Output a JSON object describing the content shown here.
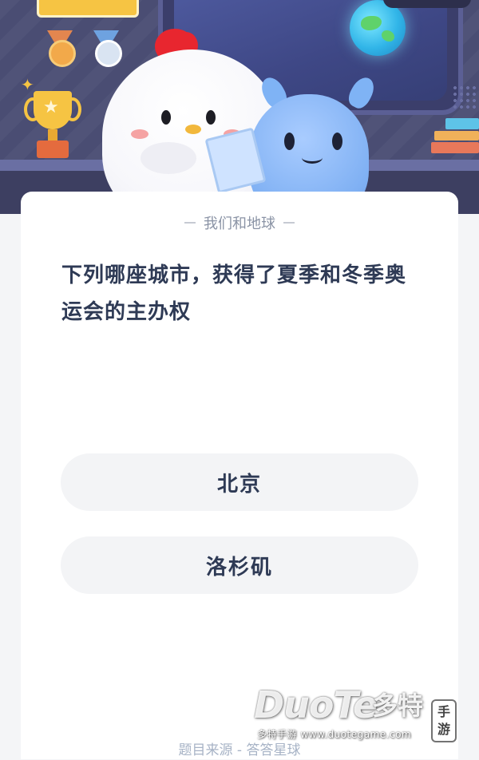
{
  "quiz": {
    "category": "我们和地球",
    "question": "下列哪座城市，获得了夏季和冬季奥运会的主办权",
    "options": [
      {
        "label": "北京"
      },
      {
        "label": "洛杉矶"
      }
    ],
    "source": "题目来源 - 答答星球"
  },
  "watermark": {
    "brand": "DuoTe",
    "brand_cn": "多特",
    "seal_1": "手",
    "seal_2": "游",
    "url": "多特手游 www.duotegame.com"
  },
  "icons": [
    "medal-bronze-icon",
    "medal-silver-icon",
    "trophy-icon",
    "planet-icon",
    "chicken-mascot",
    "alien-mascot"
  ],
  "colors": {
    "banner_bg": "#4a4d73",
    "question_text": "#2e3a55",
    "option_bg": "#f3f4f6",
    "category_text": "#8a93a5",
    "source_text": "#a7b3c6"
  }
}
